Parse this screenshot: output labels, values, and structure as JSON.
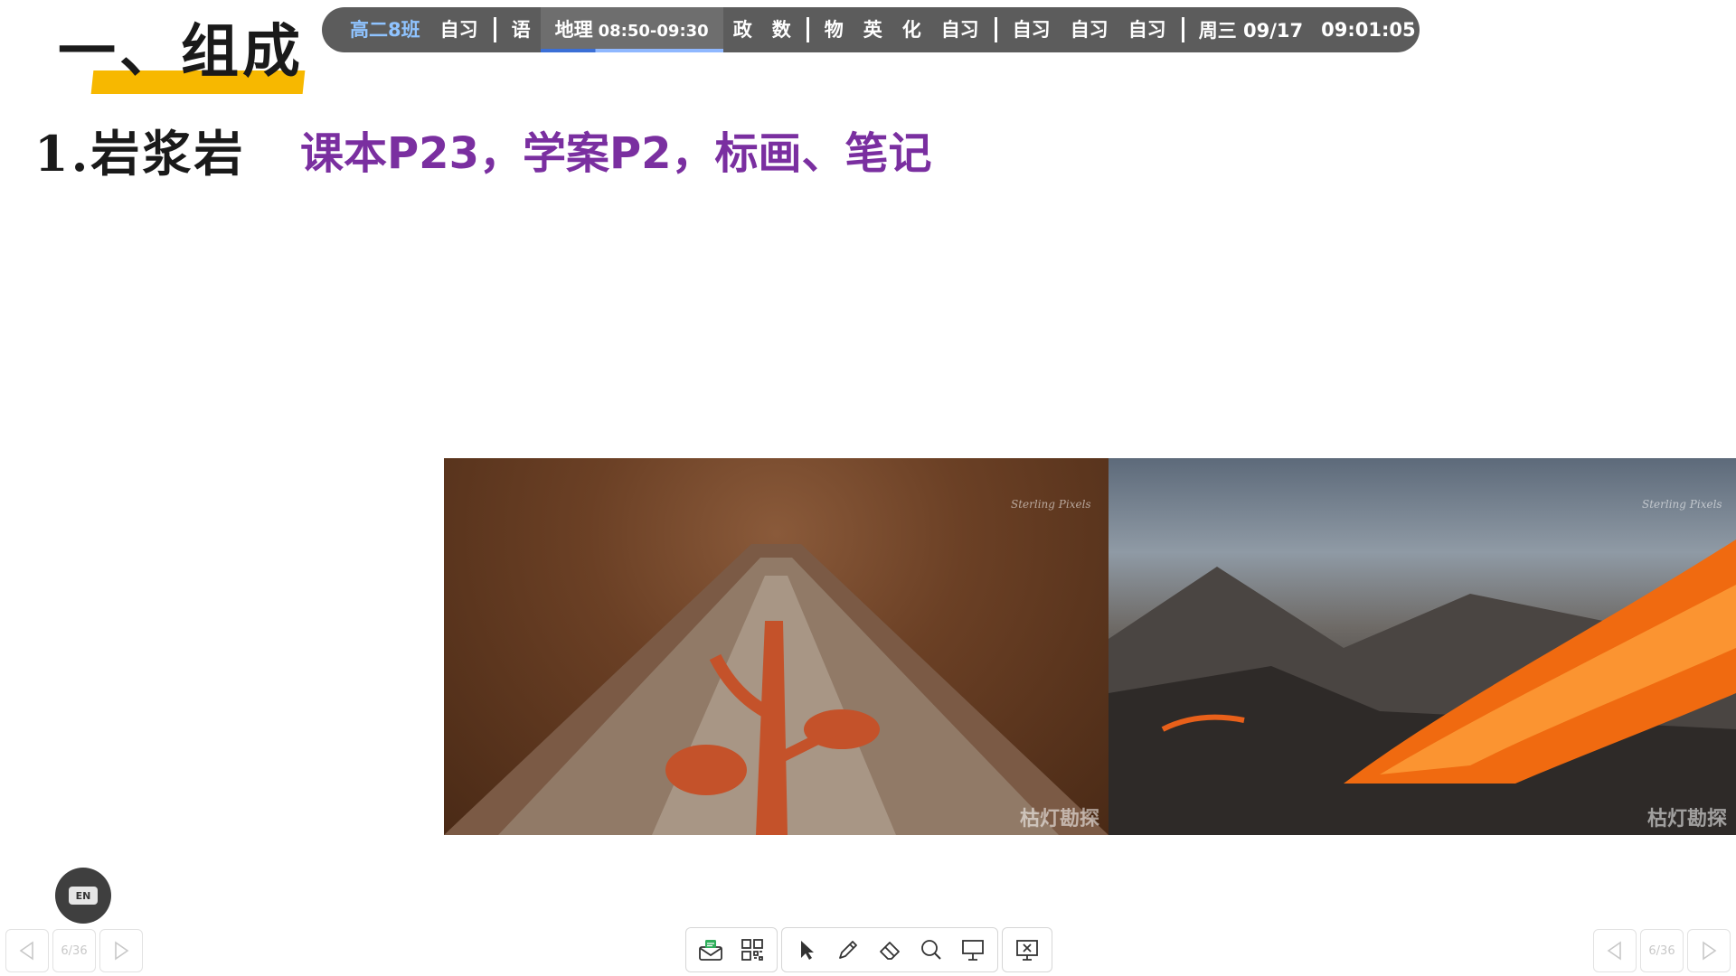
{
  "slide": {
    "title": "一、组成",
    "subtitle": "1.岩浆岩",
    "note": "课本P23，学案P2，标画、笔记"
  },
  "schedule": {
    "class_name": "高二8班",
    "items": [
      {
        "label": "自习"
      },
      {
        "label": "语"
      },
      {
        "label": "地理",
        "time": "08:50-09:30",
        "current": true
      },
      {
        "label": "政"
      },
      {
        "label": "数"
      },
      {
        "label": "物"
      },
      {
        "label": "英"
      },
      {
        "label": "化"
      },
      {
        "label": "自习"
      },
      {
        "label": "自习"
      },
      {
        "label": "自习"
      },
      {
        "label": "自习"
      }
    ],
    "date": "周三 09/17",
    "clock": "09:01:05"
  },
  "images": {
    "left": {
      "watermark_top": "Sterling Pixels",
      "watermark_bottom": "枯灯勘探"
    },
    "right": {
      "watermark_top": "Sterling Pixels",
      "watermark_bottom": "枯灯勘探"
    }
  },
  "language_button": {
    "label": "EN"
  },
  "nav_left": {
    "page": "6/36"
  },
  "nav_right": {
    "page": "6/36"
  },
  "toolbar": {
    "icons": [
      "envelope-icon",
      "qr-code-icon",
      "cursor-icon",
      "pen-icon",
      "eraser-icon",
      "magnifier-icon",
      "presentation-icon",
      "close-slideshow-icon"
    ]
  },
  "colors": {
    "title_underline": "#f7b800",
    "note_text": "#7a2fa0",
    "schedule_bg": "#5c5c5c",
    "class_name": "#8fc3ff",
    "current_indicator": "#3b6fd6"
  }
}
